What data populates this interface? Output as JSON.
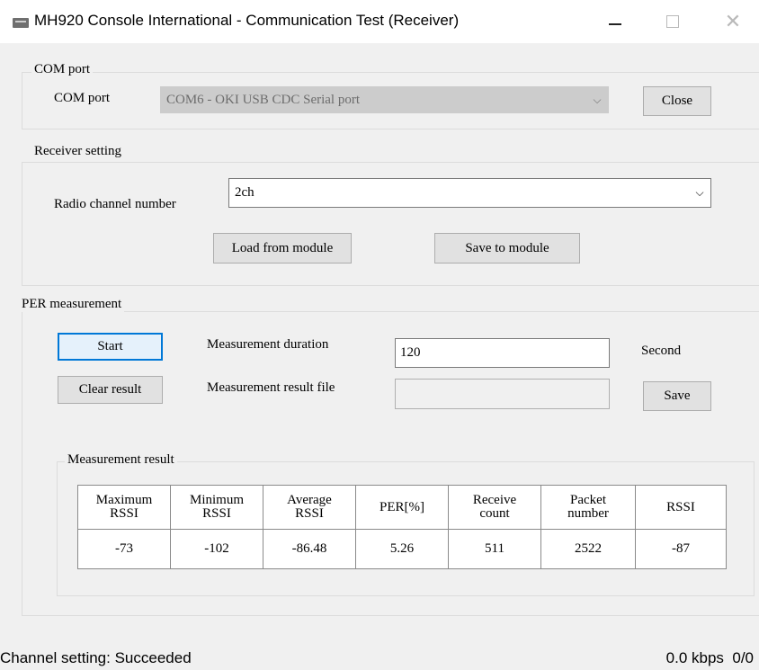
{
  "window": {
    "title": "MH920 Console International -  Communication Test (Receiver)",
    "minimize_icon": "minimize-icon",
    "maximize_icon": "maximize-icon",
    "close_icon": "close-icon",
    "close_glyph": "✕"
  },
  "com_port": {
    "group_label": "COM port",
    "label": "COM port",
    "selected": "COM6 - OKI USB CDC Serial port",
    "close_button": "Close"
  },
  "receiver_setting": {
    "group_label": "Receiver setting",
    "channel_label": "Radio channel number",
    "channel_value": "2ch",
    "load_button": "Load from module",
    "save_button": "Save to module"
  },
  "per_measurement": {
    "group_label": "PER measurement",
    "start_button": "Start",
    "clear_button": "Clear result",
    "duration_label": "Measurement duration",
    "duration_value": "120",
    "duration_unit": "Second",
    "result_file_label": "Measurement result file",
    "result_file_value": "",
    "save_button": "Save"
  },
  "measurement_result": {
    "group_label": "Measurement result",
    "columns": [
      [
        "Maximum",
        "RSSI"
      ],
      [
        "Minimum",
        "RSSI"
      ],
      [
        "Average",
        "RSSI"
      ],
      [
        "PER[%]"
      ],
      [
        "Receive",
        "count"
      ],
      [
        "Packet",
        "number"
      ],
      [
        "RSSI"
      ]
    ],
    "values": [
      "-73",
      "-102",
      "-86.48",
      "5.26",
      "511",
      "2522",
      "-87"
    ]
  },
  "status_bar": {
    "left": "Channel setting: Succeeded",
    "right": "0.0 kbps  0/0"
  }
}
